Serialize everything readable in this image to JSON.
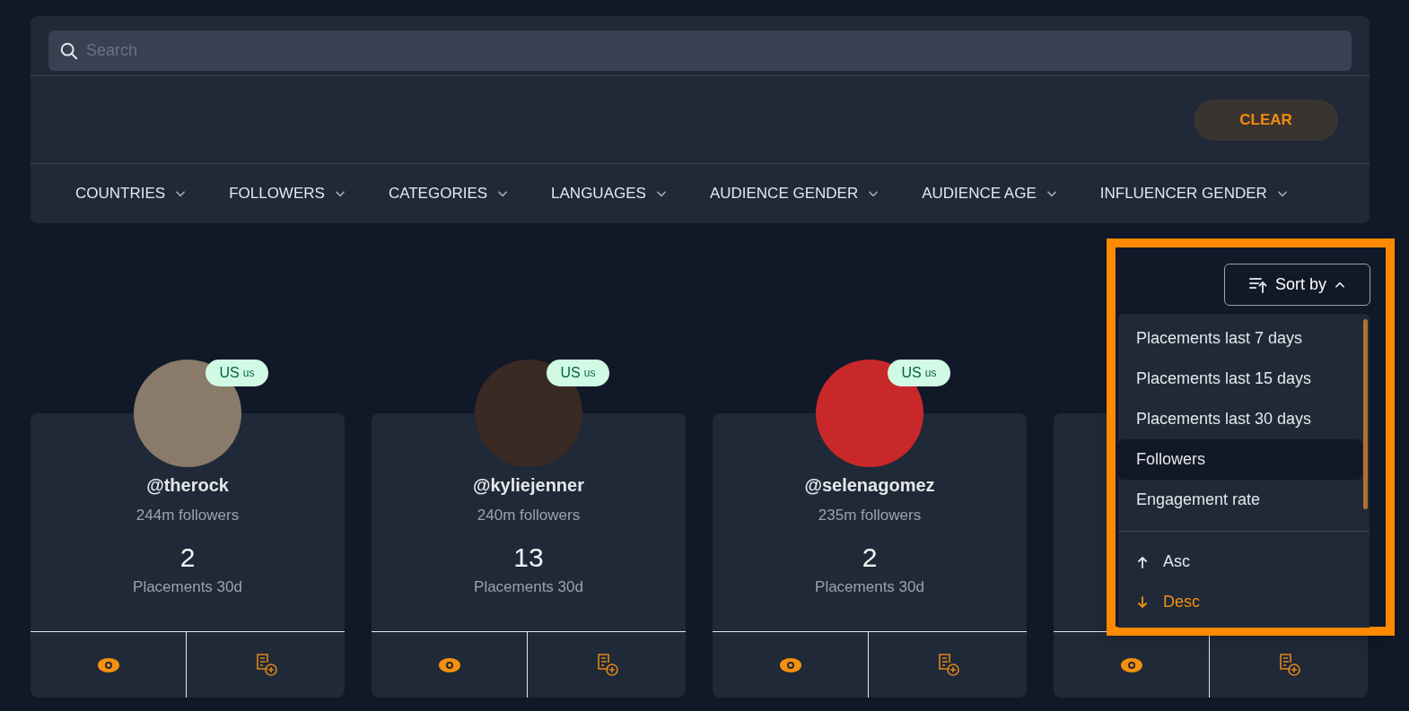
{
  "search": {
    "placeholder": "Search"
  },
  "clear_button": "CLEAR",
  "filters": [
    "COUNTRIES",
    "FOLLOWERS",
    "CATEGORIES",
    "LANGUAGES",
    "AUDIENCE GENDER",
    "AUDIENCE AGE",
    "INFLUENCER GENDER"
  ],
  "cards": [
    {
      "kind": "profile",
      "handle": "@therock",
      "followers": "244m followers",
      "count": "2",
      "count_label": "Placements 30d",
      "country": "US",
      "country_sub": "us"
    },
    {
      "kind": "profile",
      "handle": "@kyliejenner",
      "followers": "240m followers",
      "count": "13",
      "count_label": "Placements 30d",
      "country": "US",
      "country_sub": "us"
    },
    {
      "kind": "profile",
      "handle": "@selenagomez",
      "followers": "235m followers",
      "count": "2",
      "count_label": "Placements 30d",
      "country": "US",
      "country_sub": "us"
    },
    {
      "kind": "covered"
    }
  ],
  "sort": {
    "button": "Sort by",
    "expanded": true,
    "options": [
      {
        "label": "Placements last 7 days",
        "selected": false
      },
      {
        "label": "Placements last 15 days",
        "selected": false
      },
      {
        "label": "Placements last 30 days",
        "selected": false
      },
      {
        "label": "Followers",
        "selected": true
      },
      {
        "label": "Engagement rate",
        "selected": false
      }
    ],
    "orders": [
      {
        "kind": "asc",
        "label": "Asc",
        "selected": false
      },
      {
        "kind": "desc",
        "label": "Desc",
        "selected": true
      }
    ]
  }
}
